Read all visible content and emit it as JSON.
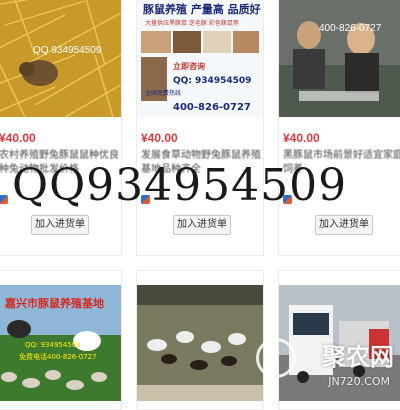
{
  "cards": [
    {
      "price": "¥40.00",
      "title": "农村养殖野兔豚鼠鼠种优良种兔动物批发价格",
      "buy_label": "加入进货单",
      "image_text": [
        "QQ 934954509"
      ]
    },
    {
      "price": "¥40.00",
      "title": "发展食草动物野兔豚鼠养殖基地品种齐全",
      "buy_label": "加入进货单",
      "image_text": [
        "豚鼠养殖 产量高 品质好",
        "大量供应黑豚鼠 逆毛豚 彩色豚鼠等",
        "立即咨询",
        "QQ: 934954509",
        "全国免费热线",
        "400-826-0727"
      ]
    },
    {
      "price": "¥40.00",
      "title": "黑豚鼠市场前景好适宜家庭饲养",
      "buy_label": "加入进货单",
      "image_text": [
        "400-826-0727"
      ]
    },
    {
      "price": "",
      "title": "",
      "buy_label": "",
      "image_text": [
        "嘉兴市豚鼠养殖基地",
        "QQ: 934954509",
        "免费电话400-826-0727"
      ]
    },
    {
      "price": "",
      "title": "",
      "buy_label": "",
      "image_text": []
    },
    {
      "price": "",
      "title": "",
      "buy_label": "",
      "image_text": []
    }
  ],
  "watermark": {
    "qq_text": "QQ934954509",
    "site_logo": "聚农网",
    "site_domain": "JN720.COM"
  }
}
